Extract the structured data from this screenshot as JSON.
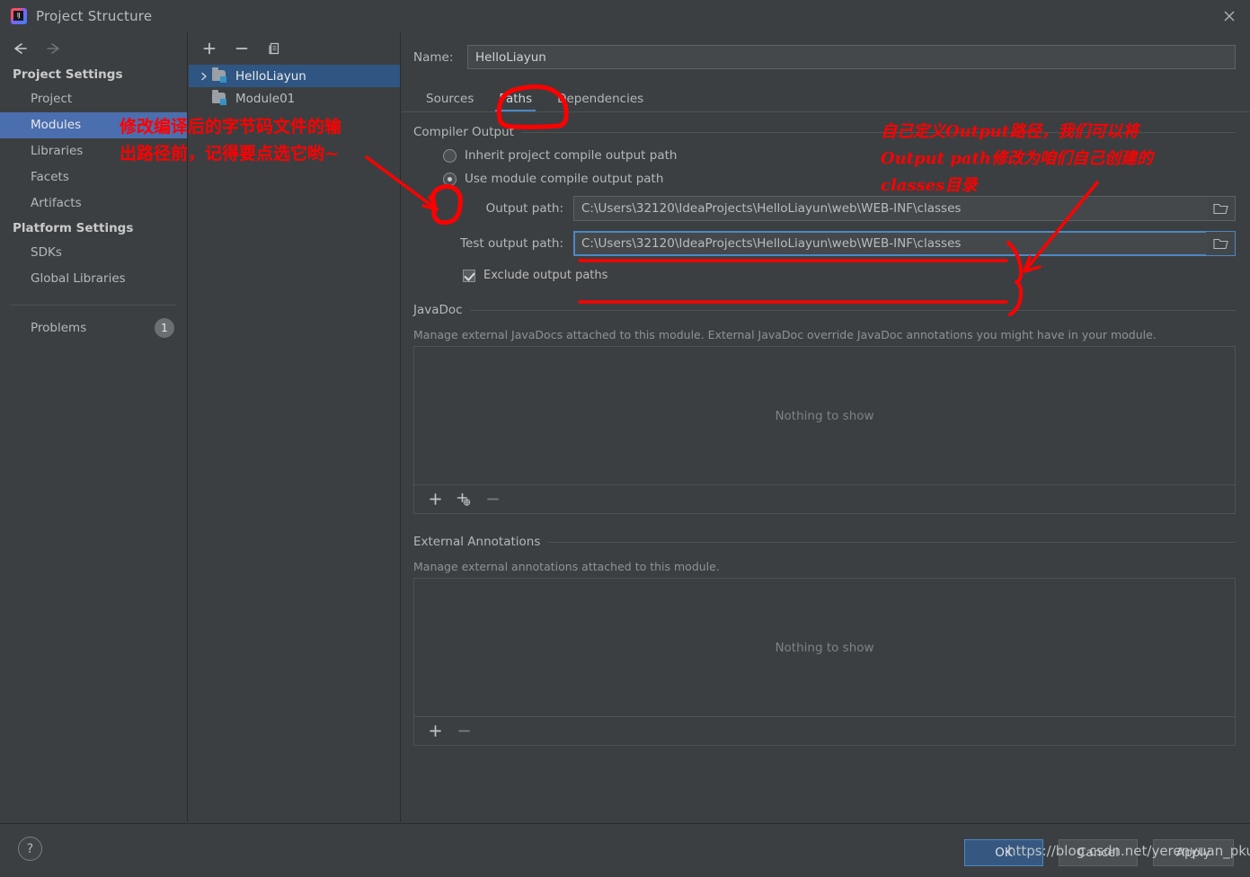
{
  "window": {
    "title": "Project Structure",
    "app_icon": "intellij-idea-icon",
    "close_icon": "close-icon"
  },
  "sidebar": {
    "back_icon": "arrow-left-icon",
    "forward_icon": "arrow-right-icon",
    "groups": [
      {
        "title": "Project Settings",
        "items": [
          {
            "label": "Project",
            "selected": false
          },
          {
            "label": "Modules",
            "selected": true
          },
          {
            "label": "Libraries",
            "selected": false
          },
          {
            "label": "Facets",
            "selected": false
          },
          {
            "label": "Artifacts",
            "selected": false
          }
        ]
      },
      {
        "title": "Platform Settings",
        "items": [
          {
            "label": "SDKs",
            "selected": false
          },
          {
            "label": "Global Libraries",
            "selected": false
          }
        ]
      }
    ],
    "problems": {
      "label": "Problems",
      "count": "1"
    }
  },
  "tree_panel": {
    "toolbar": [
      {
        "name": "add-module-button",
        "icon": "plus-icon"
      },
      {
        "name": "remove-module-button",
        "icon": "minus-icon"
      },
      {
        "name": "copy-module-button",
        "icon": "copy-icon"
      }
    ],
    "nodes": [
      {
        "label": "HelloLiayun",
        "selected": true,
        "expandable": true,
        "icon": "module-icon"
      },
      {
        "label": "Module01",
        "selected": false,
        "expandable": false,
        "icon": "module-icon"
      }
    ]
  },
  "main": {
    "name_label": "Name:",
    "name_value": "HelloLiayun",
    "tabs": [
      {
        "label": "Sources",
        "active": false
      },
      {
        "label": "Paths",
        "active": true
      },
      {
        "label": "Dependencies",
        "active": false
      }
    ],
    "compiler_output": {
      "title": "Compiler Output",
      "radio_inherit": {
        "label": "Inherit project compile output path",
        "selected": false
      },
      "radio_module": {
        "label": "Use module compile output path",
        "selected": true
      },
      "output_path": {
        "label": "Output path:",
        "value": "C:\\Users\\32120\\IdeaProjects\\HelloLiayun\\web\\WEB-INF\\classes",
        "browse_icon": "folder-icon",
        "focused": false
      },
      "test_output_path": {
        "label": "Test output path:",
        "value": "C:\\Users\\32120\\IdeaProjects\\HelloLiayun\\web\\WEB-INF\\classes",
        "browse_icon": "folder-icon",
        "focused": true
      },
      "exclude_checkbox": {
        "label": "Exclude output paths",
        "checked": true
      }
    },
    "javadoc": {
      "title": "JavaDoc",
      "hint": "Manage external JavaDocs attached to this module. External JavaDoc override JavaDoc annotations you might have in your module.",
      "empty_text": "Nothing to show",
      "toolbar": [
        {
          "name": "javadoc-add-button",
          "icon": "plus-icon"
        },
        {
          "name": "javadoc-add-url-button",
          "icon": "plus-globe-icon"
        },
        {
          "name": "javadoc-remove-button",
          "icon": "minus-icon"
        }
      ]
    },
    "external_annotations": {
      "title": "External Annotations",
      "hint": "Manage external annotations attached to this module.",
      "empty_text": "Nothing to show",
      "toolbar": [
        {
          "name": "annotations-add-button",
          "icon": "plus-icon"
        },
        {
          "name": "annotations-remove-button",
          "icon": "minus-icon"
        }
      ]
    }
  },
  "footer": {
    "help_label": "?",
    "ok_label": "OK",
    "cancel_label": "Cancel",
    "apply_label": "Apply"
  },
  "overlay": {
    "watermark": "https://blog.csdn.net/yerenyuan_pku",
    "annotation_left": "修改编译后的字节码文件的输\n出路径前，记得要点选它哟~",
    "annotation_right": "自己定义Output路径，我们可以将\nOutput path修改为咱们自己创建的\nclasses目录",
    "accent_color": "#ff0000"
  },
  "colors": {
    "window_bg": "#3c3f41",
    "selection_blue": "#4b6eaf",
    "tree_selection": "#2f5682",
    "tab_accent": "#4a88c7",
    "primary_button": "#365880",
    "annotation_red": "#ff0000"
  }
}
